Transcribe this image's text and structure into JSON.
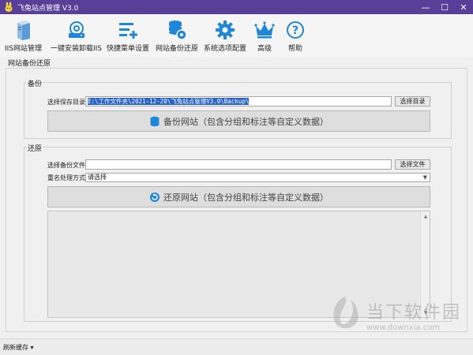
{
  "window": {
    "title": "飞兔站点管理 V3.0",
    "minimize": "—",
    "maximize": "☐",
    "close": "✕"
  },
  "toolbar": {
    "items": [
      {
        "label": "IIS网站管理",
        "icon": "server-icon"
      },
      {
        "label": "一键安装卸载IIS",
        "icon": "hard-drive-icon"
      },
      {
        "label": "快捷菜单设置",
        "icon": "menu-add-icon"
      },
      {
        "label": "网站备份还原",
        "icon": "database-icon"
      },
      {
        "label": "系统选项配置",
        "icon": "gear-icon"
      },
      {
        "label": "高级",
        "icon": "crown-icon"
      },
      {
        "label": "帮助",
        "icon": "help-icon"
      }
    ]
  },
  "main": {
    "section_title": "网站备份还原",
    "backup": {
      "legend": "备份",
      "dir_label": "选择保存目录",
      "dir_value": "E:\\工作文件夹\\2021-12-20\\飞兔站点管理V3.0\\Backup\\",
      "browse_button": "选择目录",
      "action_button": "备份网站（包含分组和标注等自定义数据）"
    },
    "restore": {
      "legend": "还原",
      "file_label": "选择备份文件",
      "file_value": "",
      "browse_button": "选择文件",
      "rename_label": "重名处理方式",
      "rename_value": "请选择",
      "action_button": "还原网站（包含分组和标注等自定义数据）"
    }
  },
  "statusbar": {
    "text": "刷新缓存 ▾"
  },
  "watermark": {
    "cn": "当下软件园",
    "url": "www.downxia.com"
  },
  "colors": {
    "titlebar": "#5a3f99",
    "icon_blue": "#1f86d8",
    "selection": "#2864c8"
  }
}
